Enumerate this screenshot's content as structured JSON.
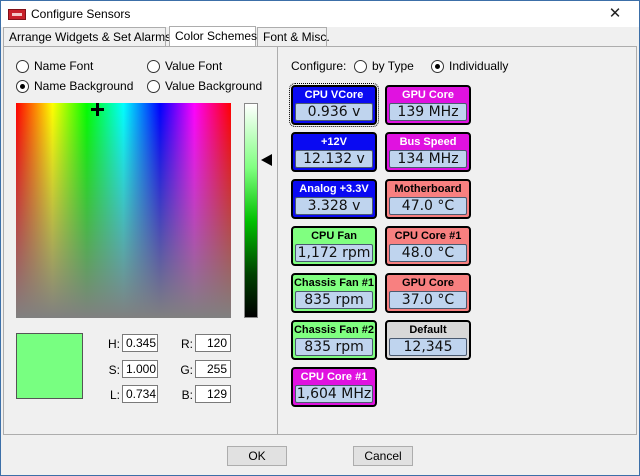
{
  "window": {
    "title": "Configure Sensors",
    "close_glyph": "✕"
  },
  "tabs": [
    {
      "label": "Arrange Widgets & Set Alarms"
    },
    {
      "label": "Color Schemes"
    },
    {
      "label": "Font & Misc."
    }
  ],
  "color_target": {
    "name_font": "Name Font",
    "value_font": "Value Font",
    "name_background": "Name Background",
    "value_background": "Value Background",
    "selected": "name_background"
  },
  "color_values": {
    "h_label": "H:",
    "h": "0.345",
    "s_label": "S:",
    "s": "1.000",
    "l_label": "L:",
    "l": "0.734",
    "r_label": "R:",
    "r": "120",
    "g_label": "G:",
    "g": "255",
    "b_label": "B:",
    "b": "129",
    "preview_color": "#78ff81"
  },
  "configure": {
    "label": "Configure:",
    "by_type": "by Type",
    "individually": "Individually",
    "selected": "individually"
  },
  "widgets": [
    {
      "name": "CPU VCore",
      "value": "0.936 v",
      "scheme": "blue"
    },
    {
      "name": "GPU Core",
      "value": "139 MHz",
      "scheme": "magenta"
    },
    {
      "name": "+12V",
      "value": "12.132 v",
      "scheme": "blue"
    },
    {
      "name": "Bus Speed",
      "value": "134 MHz",
      "scheme": "magenta"
    },
    {
      "name": "Analog +3.3V",
      "value": "3.328 v",
      "scheme": "blue"
    },
    {
      "name": "Motherboard",
      "value": "47.0 °C",
      "scheme": "red"
    },
    {
      "name": "CPU Fan",
      "value": "1,172 rpm",
      "scheme": "green"
    },
    {
      "name": "CPU Core #1",
      "value": "48.0 °C",
      "scheme": "red"
    },
    {
      "name": "Chassis Fan #1",
      "value": "835 rpm",
      "scheme": "green"
    },
    {
      "name": "GPU Core",
      "value": "37.0 °C",
      "scheme": "red"
    },
    {
      "name": "Chassis Fan #2",
      "value": "835 rpm",
      "scheme": "green"
    },
    {
      "name": "Default",
      "value": "12,345",
      "scheme": "gray"
    },
    {
      "name": "CPU Core #1",
      "value": "1,604 MHz",
      "scheme": "magenta"
    }
  ],
  "buttons": {
    "ok": "OK",
    "cancel": "Cancel"
  }
}
